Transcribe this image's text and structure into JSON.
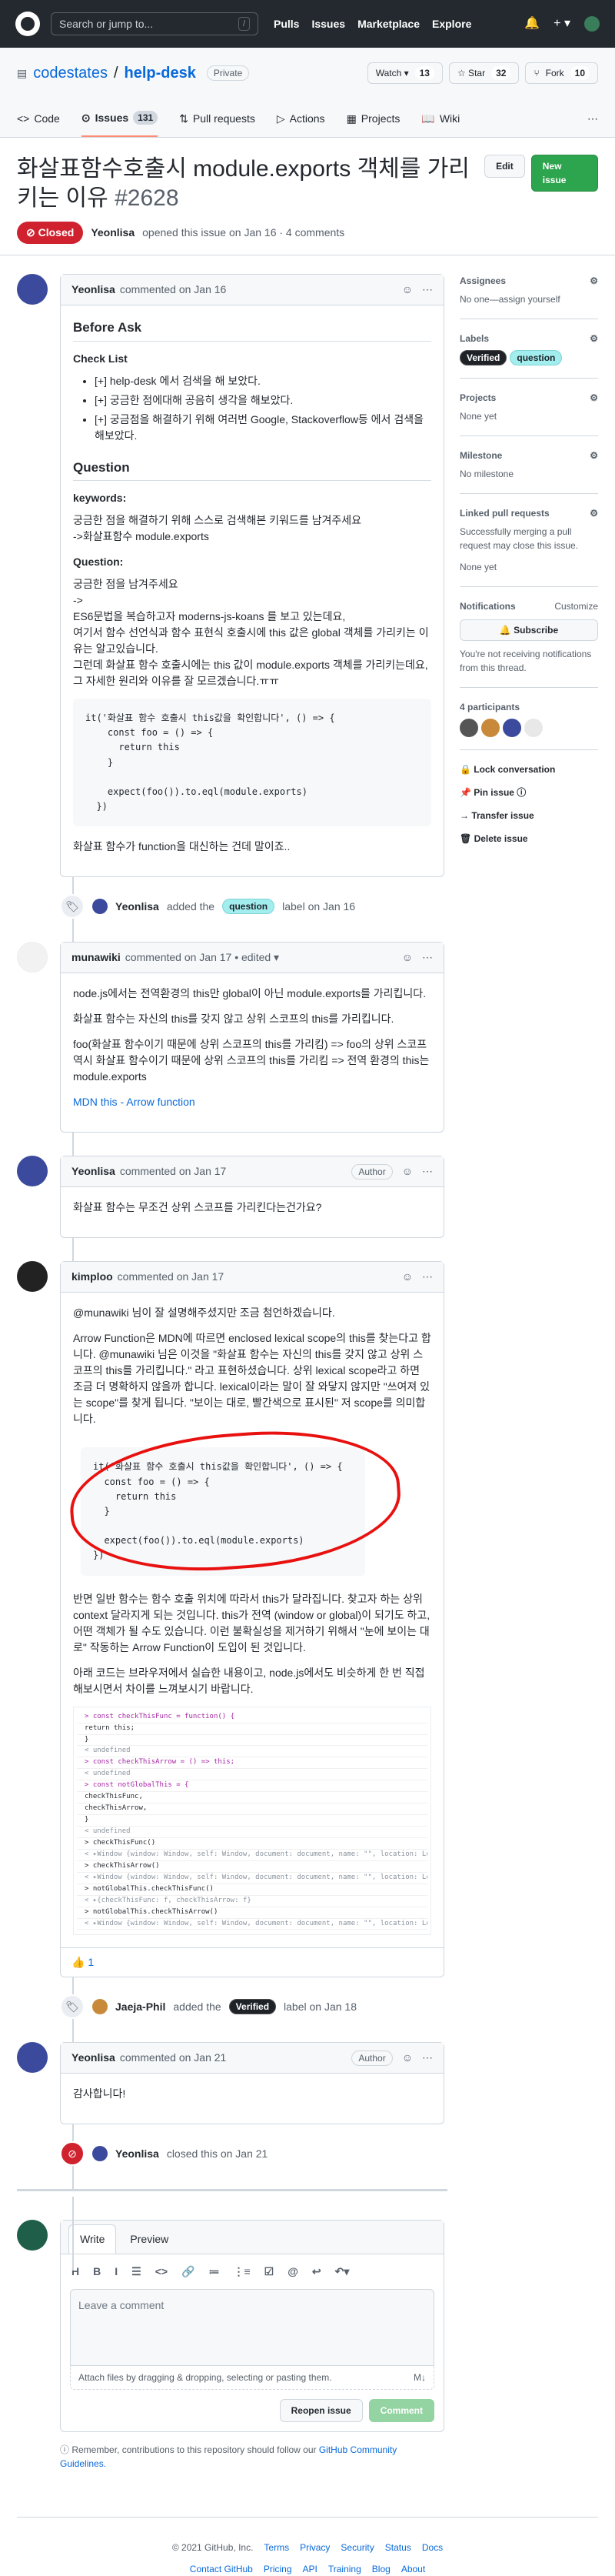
{
  "topbar": {
    "search_placeholder": "Search or jump to...",
    "slash": "/",
    "nav": [
      "Pulls",
      "Issues",
      "Marketplace",
      "Explore"
    ],
    "bell": "🔔",
    "plus": "+ ▾"
  },
  "repo": {
    "owner": "codestates",
    "sep": "/",
    "name": "help-desk",
    "visibility": "Private",
    "watch_label": "Watch ▾",
    "watch_count": "13",
    "star_label": "☆ Star",
    "star_count": "32",
    "fork_label": "Fork",
    "fork_count": "10"
  },
  "tabs": [
    {
      "label": "Code"
    },
    {
      "label": "Issues",
      "count": "131"
    },
    {
      "label": "Pull requests"
    },
    {
      "label": "Actions"
    },
    {
      "label": "Projects"
    },
    {
      "label": "Wiki"
    }
  ],
  "issue": {
    "title": "화살표함수호출시 module.exports 객체를 가리키는 이유",
    "number": "#2628",
    "edit": "Edit",
    "new_issue": "New issue",
    "state": "Closed",
    "author": "Yeonlisa",
    "meta": "opened this issue on Jan 16 · 4 comments"
  },
  "comments": {
    "c1": {
      "author": "Yeonlisa",
      "when": "commented on Jan 16",
      "h_before": "Before Ask",
      "h_checklist": "Check List",
      "checklist": [
        "[+] help-desk 에서 검색을 해 보았다.",
        "[+] 궁금한 점에대해 공음히 생각을 해보았다.",
        "[+] 궁금점을 해결하기 위해 여러번 Google, Stackoverflow등 에서 검색을 해보았다."
      ],
      "h_question": "Question",
      "h_keywords": "keywords:",
      "kw1": "궁금한 점을 해결하기 위해 스스로 검색해본 키워드를 남겨주세요",
      "kw2": "->화살표함수 module.exports",
      "h_q2": "Question:",
      "q1": "궁금한 점을 남겨주세요",
      "q2": "->",
      "q3": "ES6문법을 복습하고자 moderns-js-koans 를 보고 있는데요,",
      "q4": "여기서 함수 선언식과 함수 표현식 호출시에 this 값은 global 객체를 가리키는 이유는 알고있습니다.",
      "q5": "그런데 화살표 함수 호출시에는 this 값이 module.exports 객체를 가리키는데요,",
      "q6": "그 자세한 원리와 이유를 잘 모르겠습니다.ㅠㅠ",
      "code": "it('화살표 함수 호출시 this값을 확인합니다', () => {\n    const foo = () => {\n      return this\n    }\n\n    expect(foo()).to.eql(module.exports)\n  })",
      "last": "화살표 함수가 function을 대신하는 건데 말이죠.."
    },
    "e1": {
      "actor": "Yeonlisa",
      "text1": "added the",
      "label": "question",
      "text2": "label on Jan 16"
    },
    "c2": {
      "author": "munawiki",
      "when": "commented on Jan 17 • edited ▾",
      "p1": "node.js에서는 전역환경의 this만 global이 아닌 module.exports를 가리킵니다.",
      "p2": "화살표 함수는 자신의 this를 갖지 않고 상위 스코프의 this를 가리킵니다.",
      "p3": "foo(화살표 함수이기 때문에 상위 스코프의 this를 가리킴) => foo의 상위 스코프 역시 화살표 함수이기 때문에 상위 스코프의 this를 가리킴 => 전역 환경의 this는 module.exports",
      "link": "MDN this - Arrow function"
    },
    "c3": {
      "author": "Yeonlisa",
      "when": "commented on Jan 17",
      "tag": "Author",
      "p1": "화살표 함수는 무조건 상위 스코프를 가리킨다는건가요?"
    },
    "c4": {
      "author": "kimploo",
      "when": "commented on Jan 17",
      "p1": "@munawiki 님이 잘 설명해주셨지만 조금 첨언하겠습니다.",
      "p2": "Arrow Function은 MDN에 따르면 enclosed lexical scope의 this를 찾는다고 합니다. @munawiki 님은 이것을 \"화살표 함수는 자신의 this를 갖지 않고 상위 스코프의 this를 가리킵니다.\" 라고 표현하셨습니다. 상위 lexical scope라고 하면 조금 더 명확하지 않을까 합니다. lexical이라는 말이 잘 와닿지 않지만 \"쓰여져 있는 scope\"를 찾게 됩니다. \"보이는 대로, 빨간색으로 표시된\" 저 scope를 의미합니다.",
      "code": "it('화살표 함수 호출시 this값을 확인합니다', () => {\n  const foo = () => {\n    return this\n  }\n\n  expect(foo()).to.eql(module.exports)\n})",
      "p3": "반면 일반 함수는 함수 호출 위치에 따라서 this가 달라집니다. 찾고자 하는 상위 context 달라지게 되는 것입니다. this가 전역 (window or global)이 되기도 하고, 어떤 객체가 될 수도 있습니다. 이런 불확실성을 제거하기 위해서 \"눈에 보이는 대로\" 작동하는 Arrow Function이 도입이 된 것입니다.",
      "p4": "아래 코드는 브라우저에서 실습한 내용이고, node.js에서도 비슷하게 한 번 직접 해보시면서 차이를 느껴보시기 바랍니다.",
      "console": [
        "> const checkThisFunc = function() {",
        "    return this;",
        "  }",
        "< undefined",
        "> const checkThisArrow = () => this;",
        "< undefined",
        "> const notGlobalThis = {",
        "    checkThisFunc,",
        "    checkThisArrow,",
        "  }",
        "< undefined",
        "> checkThisFunc()",
        "< ▸Window {window: Window, self: Window, document: document, name: \"\", location: Locatio",
        "> checkThisArrow()",
        "< ▸Window {window: Window, self: Window, document: document, name: \"\", location: Locatio",
        "> notGlobalThis.checkThisFunc()",
        "< ▸{checkThisFunc: f, checkThisArrow: f}",
        "> notGlobalThis.checkThisArrow()",
        "< ▸Window {window: Window, self: Window, document: document, name: \"\", location: Locatio"
      ],
      "reaction": "👍 1"
    },
    "e2": {
      "actor": "Jaeja-Phil",
      "text1": "added the",
      "label": "Verified",
      "text2": "label on Jan 18"
    },
    "c5": {
      "author": "Yeonlisa",
      "when": "commented on Jan 21",
      "tag": "Author",
      "p1": "감사합니다!"
    },
    "e3": {
      "actor": "Yeonlisa",
      "text": "closed this on Jan 21"
    }
  },
  "new_comment": {
    "tab_write": "Write",
    "tab_preview": "Preview",
    "tools": [
      "H",
      "B",
      "I",
      "☰",
      "<>",
      "🔗",
      "≔",
      "⋮≡",
      "☑",
      "@",
      "↩",
      "↶▾"
    ],
    "placeholder": "Leave a comment",
    "attach": "Attach files by dragging & dropping, selecting or pasting them.",
    "md": "M↓",
    "reopen": "Reopen issue",
    "comment": "Comment",
    "tip_pre": "Remember, contributions to this repository should follow our",
    "tip_link": "GitHub Community Guidelines."
  },
  "sidebar": {
    "assignees": "Assignees",
    "assignees_val": "No one—assign yourself",
    "labels": "Labels",
    "label_v": "Verified",
    "label_q": "question",
    "projects": "Projects",
    "projects_val": "None yet",
    "milestone": "Milestone",
    "milestone_val": "No milestone",
    "linked": "Linked pull requests",
    "linked_val": "Successfully merging a pull request may close this issue.",
    "linked_none": "None yet",
    "notifications": "Notifications",
    "customize": "Customize",
    "subscribe": "🔔 Subscribe",
    "notif_val": "You're not receiving notifications from this thread.",
    "participants": "4 participants",
    "lock": "🔒 Lock conversation",
    "pin": "📌 Pin issue ⓘ",
    "transfer": "→ Transfer issue",
    "delete": "🗑 Delete issue"
  },
  "footer": {
    "copyright": "© 2021 GitHub, Inc.",
    "links1": [
      "Terms",
      "Privacy",
      "Security",
      "Status",
      "Docs"
    ],
    "links2": [
      "Contact GitHub",
      "Pricing",
      "API",
      "Training",
      "Blog",
      "About"
    ]
  }
}
